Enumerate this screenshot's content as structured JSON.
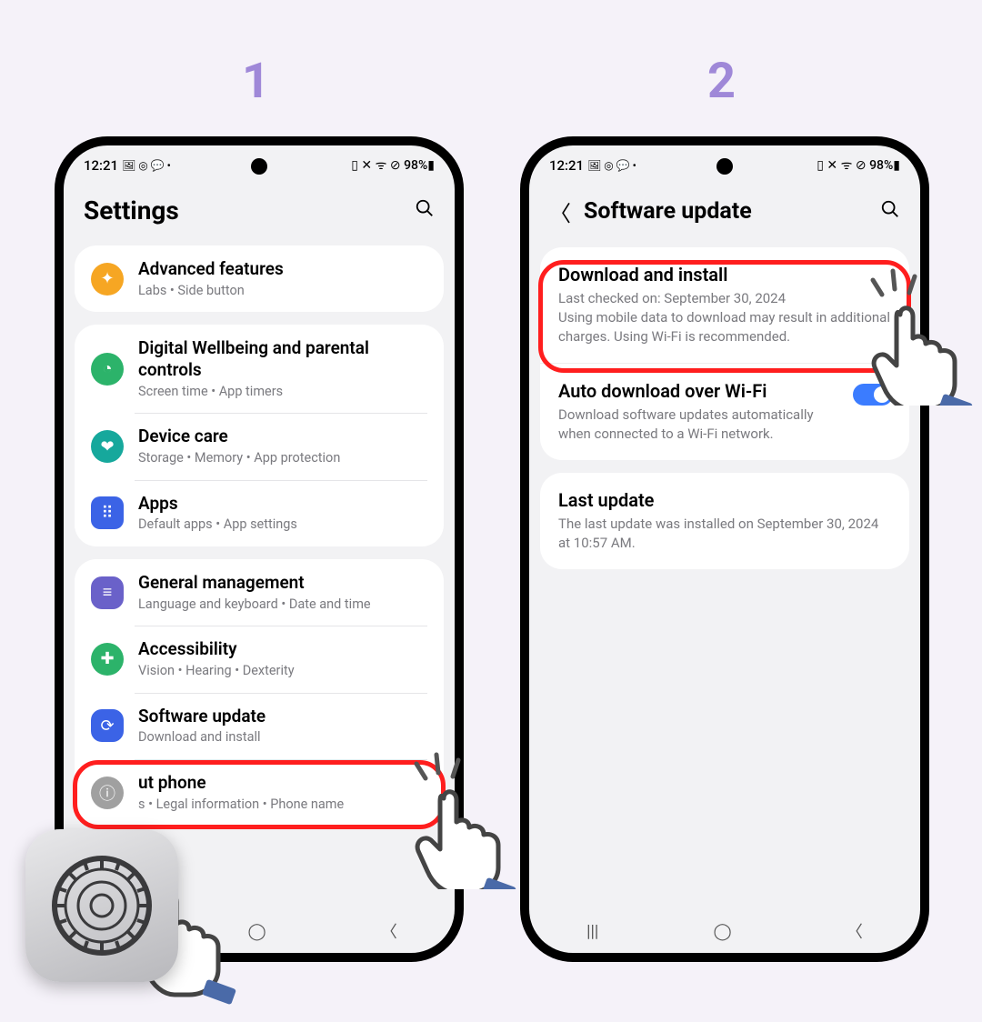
{
  "steps": {
    "one": "1",
    "two": "2"
  },
  "status": {
    "time": "12:21",
    "left_icons": "🖼 ◎ 💬 •",
    "right_text": "▯ ✕ ᯤ ⊘ 98%▮"
  },
  "phone1": {
    "title": "Settings",
    "rows": {
      "advanced": {
        "title": "Advanced features",
        "sub": "Labs  •  Side button"
      },
      "wellbeing": {
        "title": "Digital Wellbeing and parental controls",
        "sub": "Screen time  •  App timers"
      },
      "devicecare": {
        "title": "Device care",
        "sub": "Storage  •  Memory  •  App protection"
      },
      "apps": {
        "title": "Apps",
        "sub": "Default apps  •  App settings"
      },
      "general": {
        "title": "General management",
        "sub": "Language and keyboard  •  Date and time"
      },
      "access": {
        "title": "Accessibility",
        "sub": "Vision  •  Hearing  •  Dexterity"
      },
      "swupdate": {
        "title": "Software update",
        "sub": "Download and install"
      },
      "about": {
        "title": "ut phone",
        "sub": "s  •  Legal information  •  Phone name"
      }
    }
  },
  "phone2": {
    "title": "Software update",
    "download": {
      "title": "Download and install",
      "sub": "Last checked on: September 30, 2024\nUsing mobile data to download may result in additional charges. Using Wi-Fi is recommended."
    },
    "auto": {
      "title": "Auto download over Wi-Fi",
      "sub": "Download software updates automatically when connected to a Wi-Fi network."
    },
    "last": {
      "title": "Last update",
      "sub": "The last update was installed on September 30, 2024 at 10:57 AM."
    }
  }
}
